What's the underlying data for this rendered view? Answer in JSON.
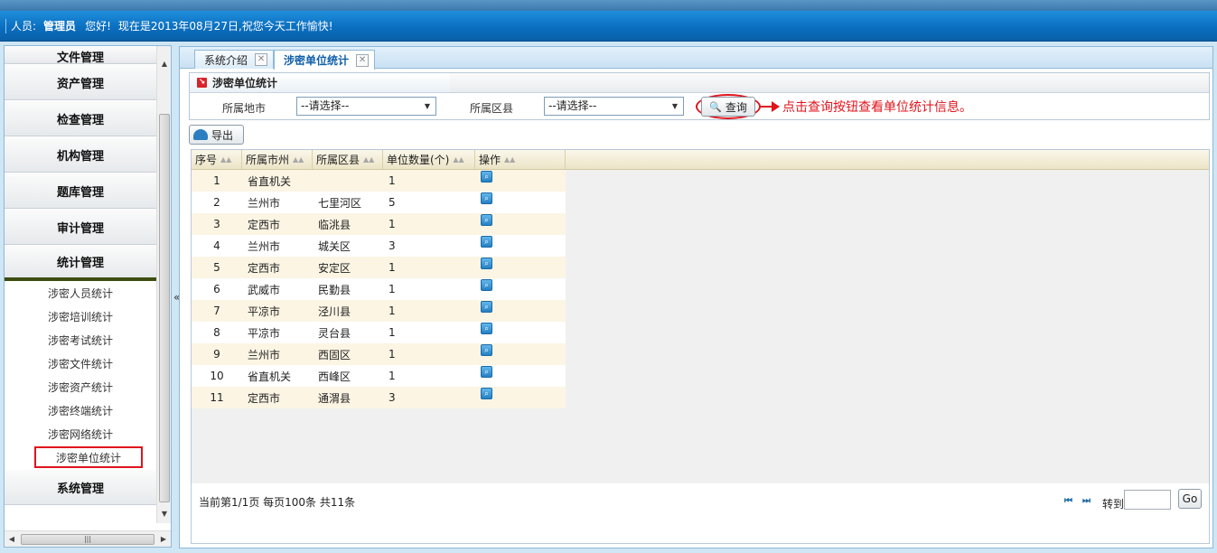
{
  "header": {
    "user_label": "人员:",
    "user_name": "管理员",
    "greeting": "您好!",
    "date_message": "现在是2013年08月27日,祝您今天工作愉快!"
  },
  "sidebar": {
    "menus": [
      {
        "label": "文件管理"
      },
      {
        "label": "资产管理"
      },
      {
        "label": "检查管理"
      },
      {
        "label": "机构管理"
      },
      {
        "label": "题库管理"
      },
      {
        "label": "审计管理"
      },
      {
        "label": "统计管理"
      }
    ],
    "sub_items": [
      {
        "label": "涉密人员统计"
      },
      {
        "label": "涉密培训统计"
      },
      {
        "label": "涉密考试统计"
      },
      {
        "label": "涉密文件统计"
      },
      {
        "label": "涉密资产统计"
      },
      {
        "label": "涉密终端统计"
      },
      {
        "label": "涉密网络统计"
      },
      {
        "label": "涉密单位统计"
      }
    ],
    "last_menu": "系统管理",
    "selected_sub": "涉密单位统计",
    "collapse_glyph": "«"
  },
  "tabs": [
    {
      "label": "系统介绍",
      "active": false
    },
    {
      "label": "涉密单位统计",
      "active": true
    }
  ],
  "panel": {
    "title": "涉密单位统计",
    "filter_city_label": "所属地市",
    "filter_city_value": "--请选择--",
    "filter_district_label": "所属区县",
    "filter_district_value": "--请选择--",
    "query_button": "查询",
    "annotation": "点击查询按钮查看单位统计信息。"
  },
  "toolbar": {
    "export_label": "导出"
  },
  "table": {
    "columns": [
      "序号",
      "所属市州",
      "所属区县",
      "单位数量(个)",
      "操作"
    ],
    "rows": [
      {
        "idx": "1",
        "city": "省直机关",
        "district": "",
        "count": "1"
      },
      {
        "idx": "2",
        "city": "兰州市",
        "district": "七里河区",
        "count": "5"
      },
      {
        "idx": "3",
        "city": "定西市",
        "district": "临洮县",
        "count": "1"
      },
      {
        "idx": "4",
        "city": "兰州市",
        "district": "城关区",
        "count": "3"
      },
      {
        "idx": "5",
        "city": "定西市",
        "district": "安定区",
        "count": "1"
      },
      {
        "idx": "6",
        "city": "武威市",
        "district": "民勤县",
        "count": "1"
      },
      {
        "idx": "7",
        "city": "平凉市",
        "district": "泾川县",
        "count": "1"
      },
      {
        "idx": "8",
        "city": "平凉市",
        "district": "灵台县",
        "count": "1"
      },
      {
        "idx": "9",
        "city": "兰州市",
        "district": "西固区",
        "count": "1"
      },
      {
        "idx": "10",
        "city": "省直机关",
        "district": "西峰区",
        "count": "1"
      },
      {
        "idx": "11",
        "city": "定西市",
        "district": "通渭县",
        "count": "3"
      }
    ]
  },
  "footer": {
    "page_info": "当前第1/1页 每页100条 共11条",
    "goto_label": "转到",
    "go_button": "Go",
    "first_glyph": "⏮",
    "last_glyph": "⏭"
  },
  "colors": {
    "accent": "#0b6fc0",
    "annotation": "#e0141c"
  }
}
